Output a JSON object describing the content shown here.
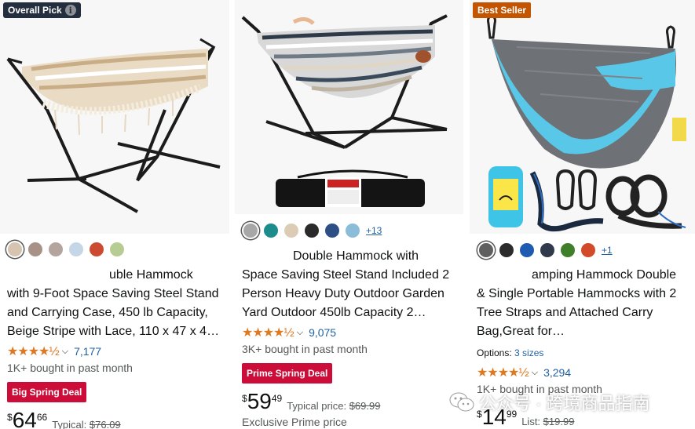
{
  "cards": [
    {
      "badge": "Overall Pick",
      "badge_info_icon": "info-icon",
      "swatches": [
        "#d6c4b1",
        "#a89187",
        "#b4a49e",
        "#c5d7e6",
        "#cc4a32",
        "#b7cc92"
      ],
      "selected_swatch": 0,
      "title_lines": [
        "uble Hammock",
        "with 9-Foot Space Saving Steel Stand",
        "and Carrying Case, 450 lb Capacity,",
        "Beige Stripe with Lace, 110 x 47 x 4…"
      ],
      "rating_stars": "★★★★½",
      "rating_value": 4.5,
      "review_count": "7,177",
      "bought": "1K+ bought in past month",
      "deal": "Big Spring Deal",
      "price_symbol": "$",
      "price_whole": "64",
      "price_fraction": "66",
      "price_label": "Typical: ",
      "price_old": "$76.09"
    },
    {
      "swatches": [
        "#a7a7a7",
        "#1c8d8c",
        "#dcccb5",
        "#2a2a2a",
        "#2e4f86",
        "#8bbcd8"
      ],
      "selected_swatch": 0,
      "more_colors": "+13",
      "title_lines": [
        "Double Hammock with",
        "Space Saving Steel Stand Included 2",
        "Person Heavy Duty Outdoor Garden",
        "Yard Outdoor 450lb Capacity 2…"
      ],
      "rating_stars": "★★★★½",
      "rating_value": 4.5,
      "review_count": "9,075",
      "bought": "3K+ bought in past month",
      "deal": "Prime Spring Deal",
      "price_symbol": "$",
      "price_whole": "59",
      "price_fraction": "49",
      "price_label": "Typical price: ",
      "price_old": "$69.99",
      "extra": "Exclusive Prime price"
    },
    {
      "badge": "Best Seller",
      "swatches": [
        "#5f5f5f",
        "#2b2b2b",
        "#1f5bb0",
        "#303a4a",
        "#3f7f2a",
        "#d24a2a"
      ],
      "selected_swatch": 0,
      "more_colors": "+1",
      "title_lines": [
        "amping Hammock Double",
        "& Single Portable Hammocks with 2",
        "Tree Straps and Attached Carry",
        "Bag,Great for…"
      ],
      "options_label": "Options: ",
      "options_link": "3 sizes",
      "rating_stars": "★★★★½",
      "rating_value": 4.5,
      "review_count": "3,294",
      "bought": "1K+ bought in past month",
      "price_symbol": "$",
      "price_whole": "14",
      "price_fraction": "99",
      "price_label": "List: ",
      "price_old": "$19.99"
    }
  ],
  "watermark": {
    "text": "公众号 · 跨境商品指南",
    "icon": "wechat-icon"
  }
}
